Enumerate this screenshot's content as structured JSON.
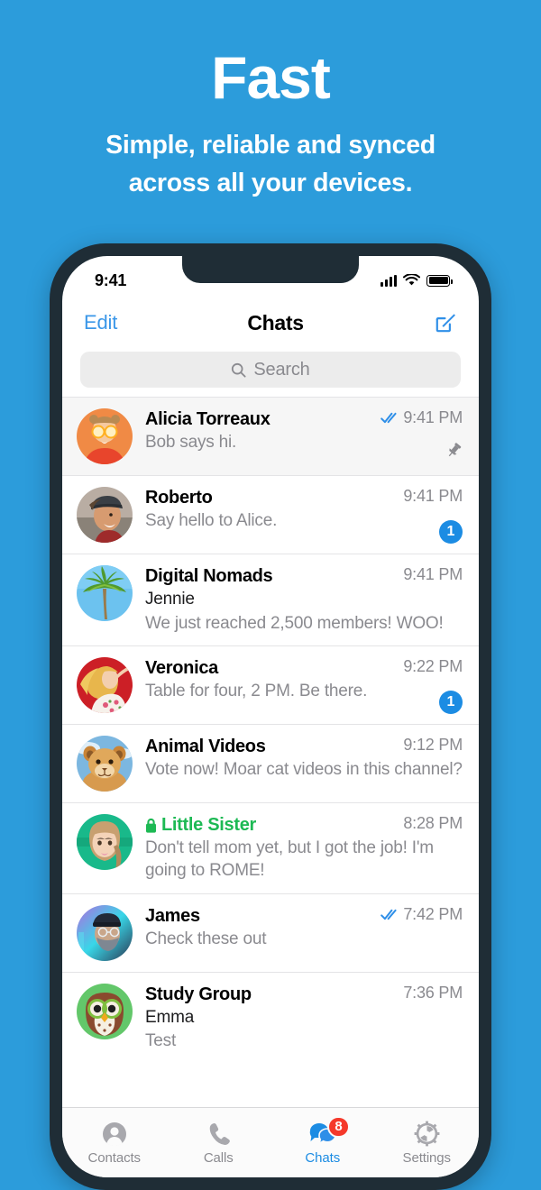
{
  "promo": {
    "title": "Fast",
    "subtitle_line1": "Simple, reliable and synced",
    "subtitle_line2": "across all your devices."
  },
  "colors": {
    "background": "#2c9cdb",
    "accent_blue": "#1c8ce3",
    "link_blue": "#3b97e8",
    "secret_green": "#1db954",
    "badge_red": "#f5392b",
    "phone_frame": "#1f2d36"
  },
  "status_bar": {
    "time": "9:41",
    "icons": [
      "cellular-signal-icon",
      "wifi-icon",
      "battery-icon"
    ]
  },
  "nav_bar": {
    "left_button": "Edit",
    "title": "Chats",
    "right_icon": "compose-icon"
  },
  "search": {
    "placeholder": "Search",
    "icon": "search-icon"
  },
  "chats": [
    {
      "name": "Alicia Torreaux",
      "sender": "",
      "message": "Bob says hi.",
      "time": "9:41 PM",
      "read_receipt": "double-check-icon",
      "badge": "",
      "pinned": true,
      "secret": false,
      "avatar": "woman-with-orange-slices"
    },
    {
      "name": "Roberto",
      "sender": "",
      "message": "Say hello to Alice.",
      "time": "9:41 PM",
      "read_receipt": "",
      "badge": "1",
      "pinned": false,
      "secret": false,
      "avatar": "man-with-cap"
    },
    {
      "name": "Digital Nomads",
      "sender": "Jennie",
      "message": "We just reached 2,500 members! WOO!",
      "time": "9:41 PM",
      "read_receipt": "",
      "badge": "",
      "pinned": false,
      "secret": false,
      "avatar": "palm-tree"
    },
    {
      "name": "Veronica",
      "sender": "",
      "message": "Table for four, 2 PM. Be there.",
      "time": "9:22 PM",
      "read_receipt": "",
      "badge": "1",
      "pinned": false,
      "secret": false,
      "avatar": "blonde-woman-red-background"
    },
    {
      "name": "Animal Videos",
      "sender": "",
      "message": "Vote now! Moar cat videos in this channel?",
      "time": "9:12 PM",
      "read_receipt": "",
      "badge": "",
      "pinned": false,
      "secret": false,
      "avatar": "lion-cub"
    },
    {
      "name": "Little Sister",
      "sender": "",
      "message": "Don't tell mom yet, but I got the job! I'm going to ROME!",
      "time": "8:28 PM",
      "read_receipt": "",
      "badge": "",
      "pinned": false,
      "secret": true,
      "avatar": "woman-with-braid-teal-background"
    },
    {
      "name": "James",
      "sender": "",
      "message": "Check these out",
      "time": "7:42 PM",
      "read_receipt": "double-check-icon",
      "badge": "",
      "pinned": false,
      "secret": false,
      "avatar": "man-with-beanie-neon-background"
    },
    {
      "name": "Study Group",
      "sender": "Emma",
      "message": "Test",
      "time": "7:36 PM",
      "read_receipt": "",
      "badge": "",
      "pinned": false,
      "secret": false,
      "avatar": "owl-illustration"
    }
  ],
  "tab_bar": {
    "tabs": [
      {
        "label": "Contacts",
        "icon": "person-icon",
        "badge": "",
        "active": false
      },
      {
        "label": "Calls",
        "icon": "phone-icon",
        "badge": "",
        "active": false
      },
      {
        "label": "Chats",
        "icon": "chat-bubbles-icon",
        "badge": "8",
        "active": true
      },
      {
        "label": "Settings",
        "icon": "gear-icon",
        "badge": "",
        "active": false
      }
    ]
  }
}
